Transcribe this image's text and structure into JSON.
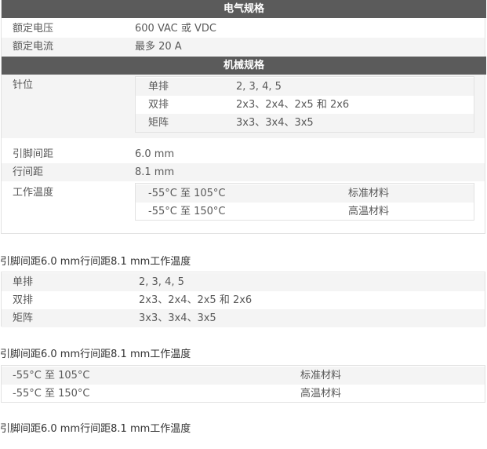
{
  "electrical": {
    "heading": "电气规格",
    "rows": [
      {
        "label": "额定电压",
        "value": "600 VAC 或 VDC"
      },
      {
        "label": "额定电流",
        "value": "最多 20 A"
      }
    ]
  },
  "mechanical": {
    "heading": "机械规格",
    "pins_label": "针位",
    "pins": [
      {
        "type": "单排",
        "values": "2, 3, 4, 5"
      },
      {
        "type": "双排",
        "values": "2x3、2x4、2x5 和 2x6"
      },
      {
        "type": "矩阵",
        "values": "3x3、3x4、3x5"
      }
    ],
    "pitch_label": "引脚间距",
    "pitch_value": "6.0 mm",
    "row_spacing_label": "行间距",
    "row_spacing_value": "8.1 mm",
    "temp_label": "工作温度",
    "temps": [
      {
        "range": "-55°C 至 105°C",
        "material": "标准材料"
      },
      {
        "range": "-55°C 至 150°C",
        "material": "高温材料"
      }
    ]
  },
  "captions": {
    "text": "引脚间距6.0 mm行间距8.1 mm工作温度"
  }
}
